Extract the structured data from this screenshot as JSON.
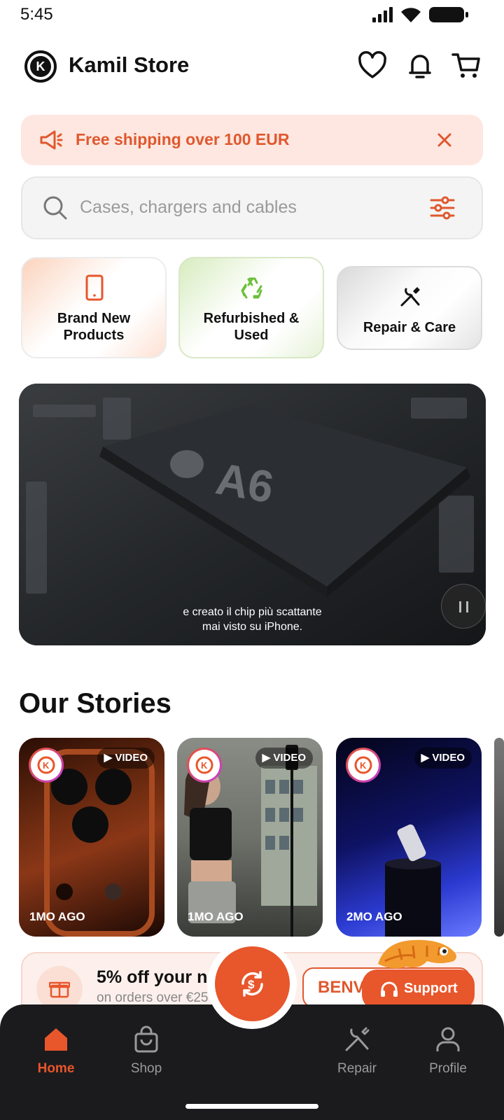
{
  "status_bar": {
    "time": "5:45"
  },
  "header": {
    "store_name": "Kamil Store"
  },
  "promo_banner": {
    "text": "Free shipping over 100 EUR"
  },
  "search": {
    "placeholder": "Cases, chargers and cables"
  },
  "categories": [
    {
      "label_line1": "Brand New",
      "label_line2": "Products"
    },
    {
      "label_line1": "Refurbished &",
      "label_line2": "Used"
    },
    {
      "label_line1": "Repair & Care"
    }
  ],
  "video": {
    "caption_line1": "e creato il chip più scattante",
    "caption_line2": "mai visto su iPhone."
  },
  "stories": {
    "title": "Our Stories",
    "items": [
      {
        "badge": "VIDEO",
        "ago": "1MO AGO"
      },
      {
        "badge": "VIDEO",
        "ago": "1MO AGO"
      },
      {
        "badge": "VIDEO",
        "ago": "2MO AGO"
      }
    ]
  },
  "discount": {
    "headline": "5% off your next order",
    "subline": "on orders over €25",
    "code": "BENV"
  },
  "support": {
    "label": "Support"
  },
  "bottom_nav": {
    "home": "Home",
    "shop": "Shop",
    "repair": "Repair",
    "profile": "Profile"
  },
  "colors": {
    "accent": "#e8562b",
    "nav_bg": "#1b1b1d",
    "banner_bg": "#fde7e0"
  }
}
